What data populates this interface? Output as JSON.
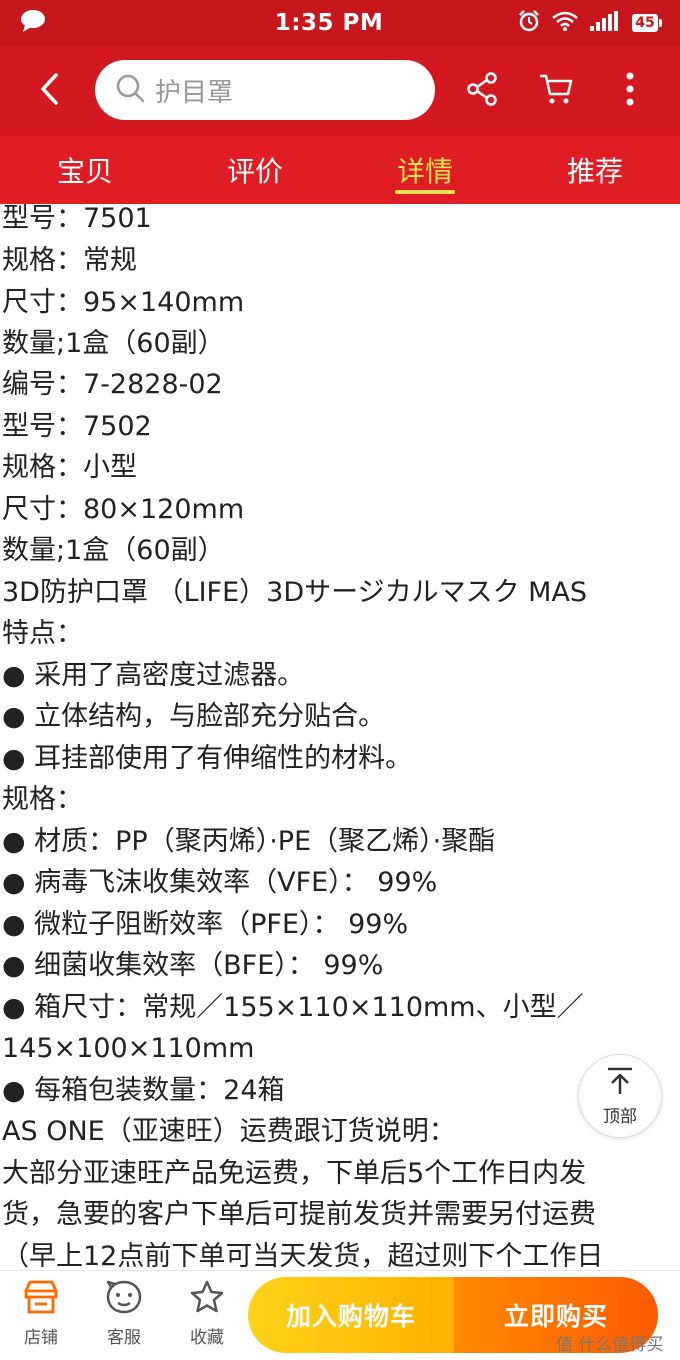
{
  "status_bar": {
    "time": "1:35 PM",
    "battery": "45"
  },
  "search": {
    "placeholder": "护目罩"
  },
  "tabs": [
    {
      "label": "宝贝",
      "active": false
    },
    {
      "label": "评价",
      "active": false
    },
    {
      "label": "详情",
      "active": true
    },
    {
      "label": "推荐",
      "active": false
    }
  ],
  "content_lines": [
    "型号：7501",
    "规格：常规",
    "尺寸：95×140mm",
    "数量;1盒（60副）",
    "编号：7-2828-02",
    "型号：7502",
    "规格：小型",
    "尺寸：80×120mm",
    "数量;1盒（60副）",
    "3D防护口罩 （LIFE）3Dサージカルマスク MAS",
    "特点：",
    "● 采用了高密度过滤器。",
    "● 立体结构，与脸部充分贴合。",
    "● 耳挂部使用了有伸缩性的材料。",
    "规格：",
    "● 材质：PP（聚丙烯）·PE（聚乙烯）·聚酯",
    "● 病毒飞沫收集效率（VFE）： 99%",
    "● 微粒子阻断效率（PFE）： 99%",
    "● 细菌收集效率（BFE）： 99%",
    "● 箱尺寸：常规／155×110×110mm、小型／",
    "145×100×110mm",
    "● 每箱包装数量：24箱",
    "AS ONE（亚速旺）运费跟订货说明：",
    "大部分亚速旺产品免运费，下单后5个工作日内发",
    "货，急要的客户下单后可提前发货并需要另付运费",
    "（早上12点前下单可当天发货，超过则下个工作日"
  ],
  "back_to_top": {
    "label": "顶部"
  },
  "bottom_bar": {
    "shop_label": "店铺",
    "service_label": "客服",
    "favorite_label": "收藏",
    "add_to_cart_label": "加入购物车",
    "buy_now_label": "立即购买"
  },
  "watermark": "值 什么值得买",
  "colors": {
    "header_red": "#d3181f",
    "tab_red": "#e01c24",
    "active_tab": "#ffe14d",
    "cart_yellow": "#ffc20e",
    "buy_orange": "#ff6a00"
  }
}
